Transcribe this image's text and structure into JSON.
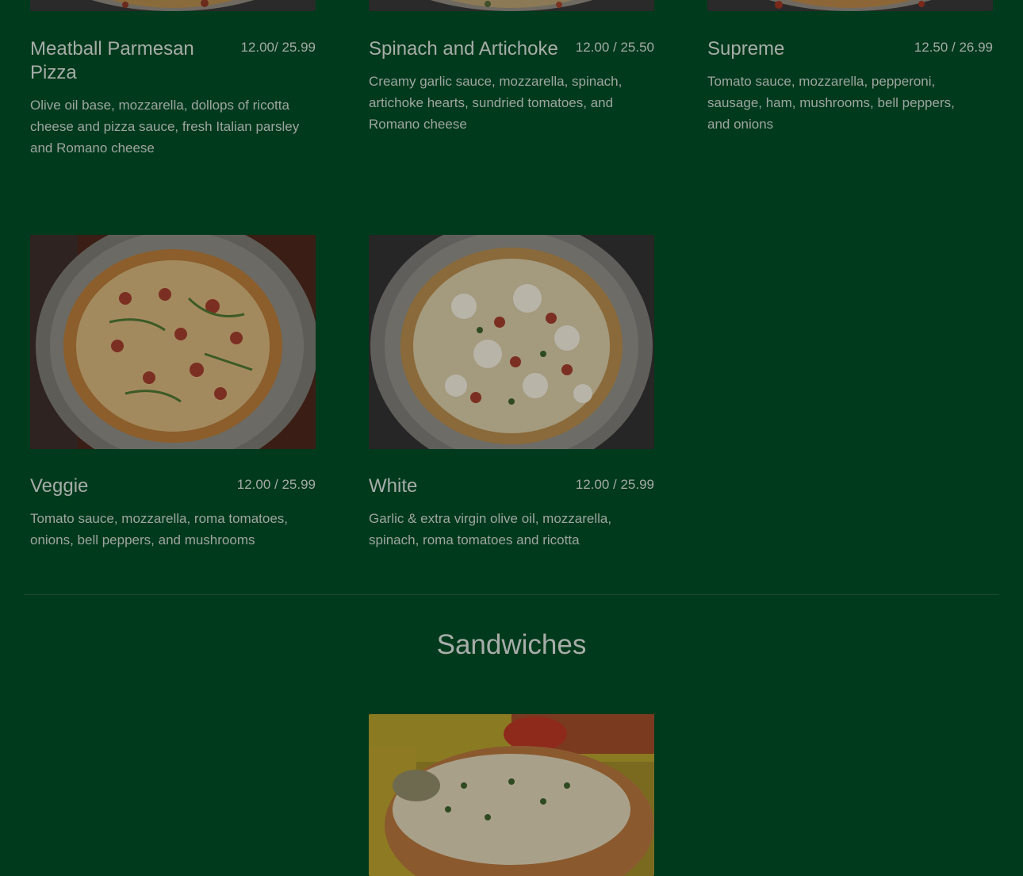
{
  "pizzas": [
    {
      "title": "Meatball Parmesan Pizza",
      "price": "12.00/ 25.99",
      "description": "Olive oil base, mozzarella, dollops of ricotta cheese and pizza sauce, fresh Italian parsley and Romano cheese"
    },
    {
      "title": "Spinach and Artichoke",
      "price": "12.00 / 25.50",
      "description": "Creamy garlic sauce, mozzarella, spinach, artichoke hearts, sundried tomatoes, and Romano cheese"
    },
    {
      "title": "Supreme",
      "price": "12.50 / 26.99",
      "description": "Tomato sauce, mozzarella, pepperoni, sausage, ham, mushrooms, bell peppers, and onions"
    },
    {
      "title": "Veggie",
      "price": "12.00 / 25.99",
      "description": "Tomato sauce, mozzarella, roma tomatoes, onions, bell peppers, and mushrooms"
    },
    {
      "title": "White",
      "price": "12.00 / 25.99",
      "description": "Garlic & extra virgin olive oil, mozzarella, spinach, roma tomatoes and ricotta"
    }
  ],
  "sandwiches": {
    "section_title": "Sandwiches"
  },
  "colors": {
    "background": "#003a1c",
    "text": "#a7ada8"
  }
}
